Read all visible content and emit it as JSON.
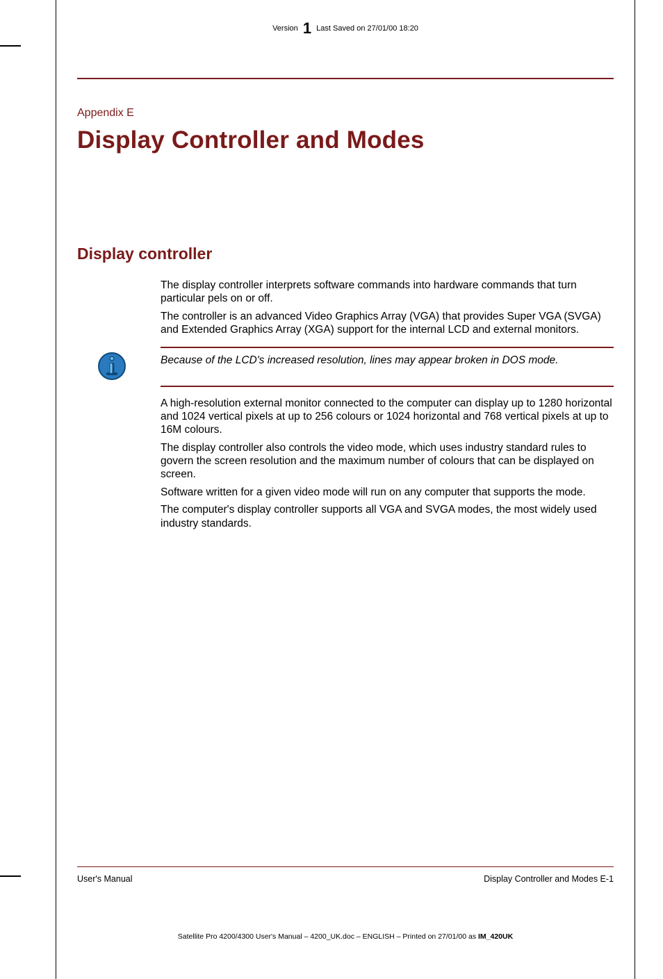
{
  "header": {
    "version_label": "Version",
    "version_num": "1",
    "saved_text": "Last Saved on 27/01/00 18:20"
  },
  "appendix_label": "Appendix E",
  "page_title": "Display Controller and Modes",
  "section_title": "Display controller",
  "paragraphs": {
    "p1": "The display controller interprets software commands into hardware commands that turn particular pels on or off.",
    "p2": "The controller is an advanced Video Graphics Array (VGA) that provides Super VGA (SVGA) and Extended Graphics Array (XGA) support for the internal LCD and external monitors.",
    "note": "Because of the LCD's increased resolution, lines may appear broken in DOS mode.",
    "p3": "A high-resolution external monitor connected to the computer can display up to 1280 horizontal and 1024 vertical pixels at up to 256 colours or 1024 horizontal and 768 vertical pixels at up to 16M colours.",
    "p4": "The display controller also controls the video mode, which uses industry standard rules to govern the screen resolution and the maximum number of colours that can be displayed on screen.",
    "p5": "Software written for a given video mode will run on any computer that supports the mode.",
    "p6": "The computer's display controller supports all VGA and SVGA modes, the most widely used industry standards."
  },
  "footer": {
    "left": "User's Manual",
    "right": "Display Controller and Modes  E-1"
  },
  "print_line": {
    "text": "Satellite Pro 4200/4300 User's Manual  – 4200_UK.doc – ENGLISH – Printed on 27/01/00 as ",
    "bold": "IM_420UK"
  },
  "icons": {
    "info": "info-icon"
  },
  "colors": {
    "accent": "#7a1a1a"
  }
}
